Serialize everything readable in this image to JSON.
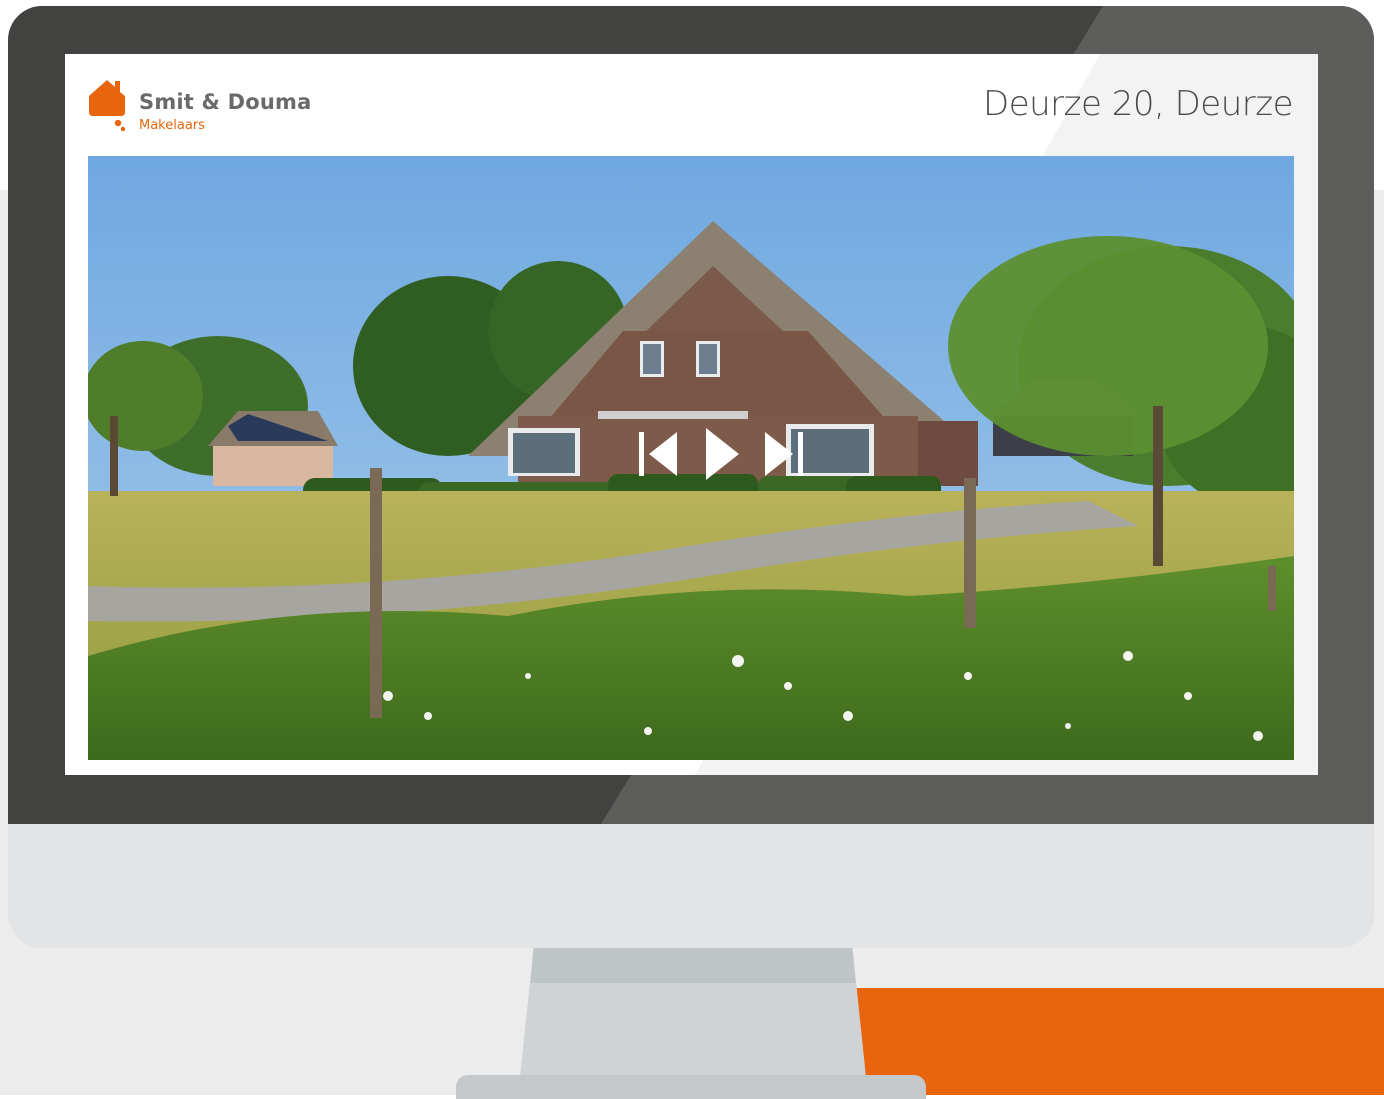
{
  "brand": {
    "name": "Smit & Douma",
    "subtitle": "Makelaars",
    "accent_color": "#e8650d",
    "logo_icon": "house-icon"
  },
  "listing": {
    "address": "Deurze 20, Deurze"
  },
  "slideshow": {
    "controls": [
      {
        "name": "previous-slide-button",
        "icon": "skip-previous-icon"
      },
      {
        "name": "play-button",
        "icon": "play-icon"
      },
      {
        "name": "next-slide-button",
        "icon": "skip-next-icon"
      }
    ],
    "photo_subject": "thatched-roof farmhouse in a meadow"
  },
  "colors": {
    "bezel": "#424241",
    "chin": "#e2e4e6",
    "background_band": "#ececec",
    "orange_block": "#e8650d"
  }
}
